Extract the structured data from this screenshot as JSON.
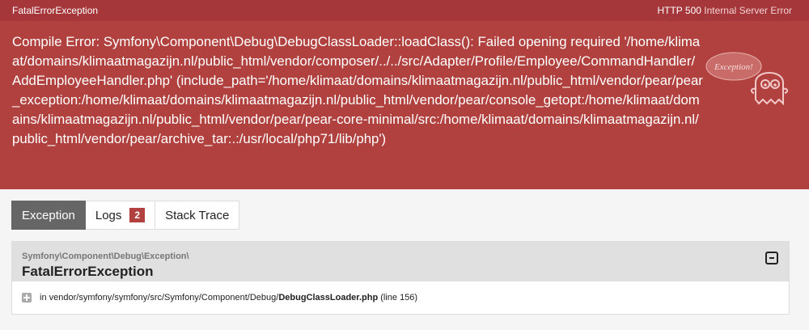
{
  "header": {
    "exception_class": "FatalErrorException",
    "status_code": "HTTP 500",
    "status_text": "Internal Server Error"
  },
  "error": {
    "message": "Compile Error: Symfony\\Component\\Debug\\DebugClassLoader::loadClass(): Failed opening required '/home/klimaat/domains/klimaatmagazijn.nl/public_html/vendor/composer/../../src/Adapter/Profile/Employee/CommandHandler/AddEmployeeHandler.php' (include_path='/home/klimaat/domains/klimaatmagazijn.nl/public_html/vendor/pear/pear_exception:/home/klimaat/domains/klimaatmagazijn.nl/public_html/vendor/pear/console_getopt:/home/klimaat/domains/klimaatmagazijn.nl/public_html/vendor/pear/pear-core-minimal/src:/home/klimaat/domains/klimaatmagazijn.nl/public_html/vendor/pear/archive_tar:.:/usr/local/php71/lib/php')",
    "mascot_label": "Exception!"
  },
  "tabs": [
    {
      "label": "Exception",
      "active": true
    },
    {
      "label": "Logs",
      "badge": "2"
    },
    {
      "label": "Stack Trace"
    }
  ],
  "trace": {
    "namespace": "Symfony\\Component\\Debug\\Exception\\",
    "class": "FatalErrorException",
    "line_prefix": "in",
    "path": "vendor/symfony/symfony/src/Symfony/Component/Debug/",
    "file": "DebugClassLoader.php",
    "line": "(line 156)"
  },
  "colors": {
    "topbar": "#a5373b",
    "error_panel": "#b0413e",
    "active_tab": "#666666"
  }
}
